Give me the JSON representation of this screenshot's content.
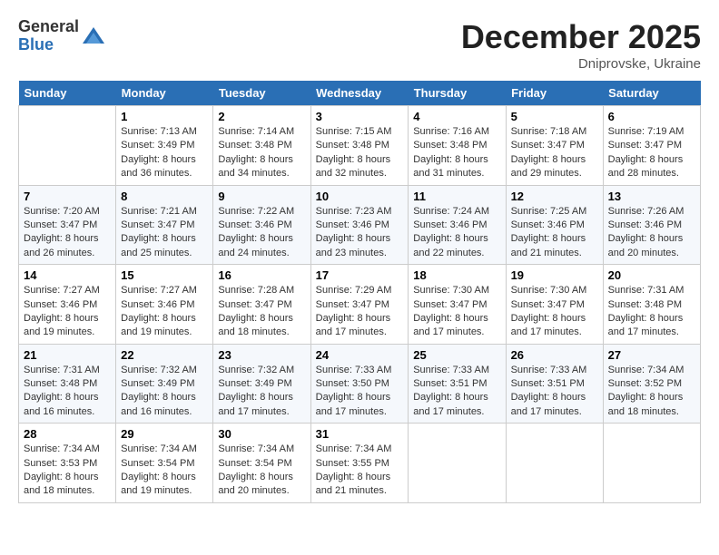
{
  "header": {
    "logo": {
      "general": "General",
      "blue": "Blue"
    },
    "title": "December 2025",
    "location": "Dniprovske, Ukraine"
  },
  "weekdays": [
    "Sunday",
    "Monday",
    "Tuesday",
    "Wednesday",
    "Thursday",
    "Friday",
    "Saturday"
  ],
  "weeks": [
    [
      {
        "day": "",
        "sunrise": "",
        "sunset": "",
        "daylight": ""
      },
      {
        "day": "1",
        "sunrise": "Sunrise: 7:13 AM",
        "sunset": "Sunset: 3:49 PM",
        "daylight": "Daylight: 8 hours and 36 minutes."
      },
      {
        "day": "2",
        "sunrise": "Sunrise: 7:14 AM",
        "sunset": "Sunset: 3:48 PM",
        "daylight": "Daylight: 8 hours and 34 minutes."
      },
      {
        "day": "3",
        "sunrise": "Sunrise: 7:15 AM",
        "sunset": "Sunset: 3:48 PM",
        "daylight": "Daylight: 8 hours and 32 minutes."
      },
      {
        "day": "4",
        "sunrise": "Sunrise: 7:16 AM",
        "sunset": "Sunset: 3:48 PM",
        "daylight": "Daylight: 8 hours and 31 minutes."
      },
      {
        "day": "5",
        "sunrise": "Sunrise: 7:18 AM",
        "sunset": "Sunset: 3:47 PM",
        "daylight": "Daylight: 8 hours and 29 minutes."
      },
      {
        "day": "6",
        "sunrise": "Sunrise: 7:19 AM",
        "sunset": "Sunset: 3:47 PM",
        "daylight": "Daylight: 8 hours and 28 minutes."
      }
    ],
    [
      {
        "day": "7",
        "sunrise": "Sunrise: 7:20 AM",
        "sunset": "Sunset: 3:47 PM",
        "daylight": "Daylight: 8 hours and 26 minutes."
      },
      {
        "day": "8",
        "sunrise": "Sunrise: 7:21 AM",
        "sunset": "Sunset: 3:47 PM",
        "daylight": "Daylight: 8 hours and 25 minutes."
      },
      {
        "day": "9",
        "sunrise": "Sunrise: 7:22 AM",
        "sunset": "Sunset: 3:46 PM",
        "daylight": "Daylight: 8 hours and 24 minutes."
      },
      {
        "day": "10",
        "sunrise": "Sunrise: 7:23 AM",
        "sunset": "Sunset: 3:46 PM",
        "daylight": "Daylight: 8 hours and 23 minutes."
      },
      {
        "day": "11",
        "sunrise": "Sunrise: 7:24 AM",
        "sunset": "Sunset: 3:46 PM",
        "daylight": "Daylight: 8 hours and 22 minutes."
      },
      {
        "day": "12",
        "sunrise": "Sunrise: 7:25 AM",
        "sunset": "Sunset: 3:46 PM",
        "daylight": "Daylight: 8 hours and 21 minutes."
      },
      {
        "day": "13",
        "sunrise": "Sunrise: 7:26 AM",
        "sunset": "Sunset: 3:46 PM",
        "daylight": "Daylight: 8 hours and 20 minutes."
      }
    ],
    [
      {
        "day": "14",
        "sunrise": "Sunrise: 7:27 AM",
        "sunset": "Sunset: 3:46 PM",
        "daylight": "Daylight: 8 hours and 19 minutes."
      },
      {
        "day": "15",
        "sunrise": "Sunrise: 7:27 AM",
        "sunset": "Sunset: 3:46 PM",
        "daylight": "Daylight: 8 hours and 19 minutes."
      },
      {
        "day": "16",
        "sunrise": "Sunrise: 7:28 AM",
        "sunset": "Sunset: 3:47 PM",
        "daylight": "Daylight: 8 hours and 18 minutes."
      },
      {
        "day": "17",
        "sunrise": "Sunrise: 7:29 AM",
        "sunset": "Sunset: 3:47 PM",
        "daylight": "Daylight: 8 hours and 17 minutes."
      },
      {
        "day": "18",
        "sunrise": "Sunrise: 7:30 AM",
        "sunset": "Sunset: 3:47 PM",
        "daylight": "Daylight: 8 hours and 17 minutes."
      },
      {
        "day": "19",
        "sunrise": "Sunrise: 7:30 AM",
        "sunset": "Sunset: 3:47 PM",
        "daylight": "Daylight: 8 hours and 17 minutes."
      },
      {
        "day": "20",
        "sunrise": "Sunrise: 7:31 AM",
        "sunset": "Sunset: 3:48 PM",
        "daylight": "Daylight: 8 hours and 17 minutes."
      }
    ],
    [
      {
        "day": "21",
        "sunrise": "Sunrise: 7:31 AM",
        "sunset": "Sunset: 3:48 PM",
        "daylight": "Daylight: 8 hours and 16 minutes."
      },
      {
        "day": "22",
        "sunrise": "Sunrise: 7:32 AM",
        "sunset": "Sunset: 3:49 PM",
        "daylight": "Daylight: 8 hours and 16 minutes."
      },
      {
        "day": "23",
        "sunrise": "Sunrise: 7:32 AM",
        "sunset": "Sunset: 3:49 PM",
        "daylight": "Daylight: 8 hours and 17 minutes."
      },
      {
        "day": "24",
        "sunrise": "Sunrise: 7:33 AM",
        "sunset": "Sunset: 3:50 PM",
        "daylight": "Daylight: 8 hours and 17 minutes."
      },
      {
        "day": "25",
        "sunrise": "Sunrise: 7:33 AM",
        "sunset": "Sunset: 3:51 PM",
        "daylight": "Daylight: 8 hours and 17 minutes."
      },
      {
        "day": "26",
        "sunrise": "Sunrise: 7:33 AM",
        "sunset": "Sunset: 3:51 PM",
        "daylight": "Daylight: 8 hours and 17 minutes."
      },
      {
        "day": "27",
        "sunrise": "Sunrise: 7:34 AM",
        "sunset": "Sunset: 3:52 PM",
        "daylight": "Daylight: 8 hours and 18 minutes."
      }
    ],
    [
      {
        "day": "28",
        "sunrise": "Sunrise: 7:34 AM",
        "sunset": "Sunset: 3:53 PM",
        "daylight": "Daylight: 8 hours and 18 minutes."
      },
      {
        "day": "29",
        "sunrise": "Sunrise: 7:34 AM",
        "sunset": "Sunset: 3:54 PM",
        "daylight": "Daylight: 8 hours and 19 minutes."
      },
      {
        "day": "30",
        "sunrise": "Sunrise: 7:34 AM",
        "sunset": "Sunset: 3:54 PM",
        "daylight": "Daylight: 8 hours and 20 minutes."
      },
      {
        "day": "31",
        "sunrise": "Sunrise: 7:34 AM",
        "sunset": "Sunset: 3:55 PM",
        "daylight": "Daylight: 8 hours and 21 minutes."
      },
      {
        "day": "",
        "sunrise": "",
        "sunset": "",
        "daylight": ""
      },
      {
        "day": "",
        "sunrise": "",
        "sunset": "",
        "daylight": ""
      },
      {
        "day": "",
        "sunrise": "",
        "sunset": "",
        "daylight": ""
      }
    ]
  ]
}
